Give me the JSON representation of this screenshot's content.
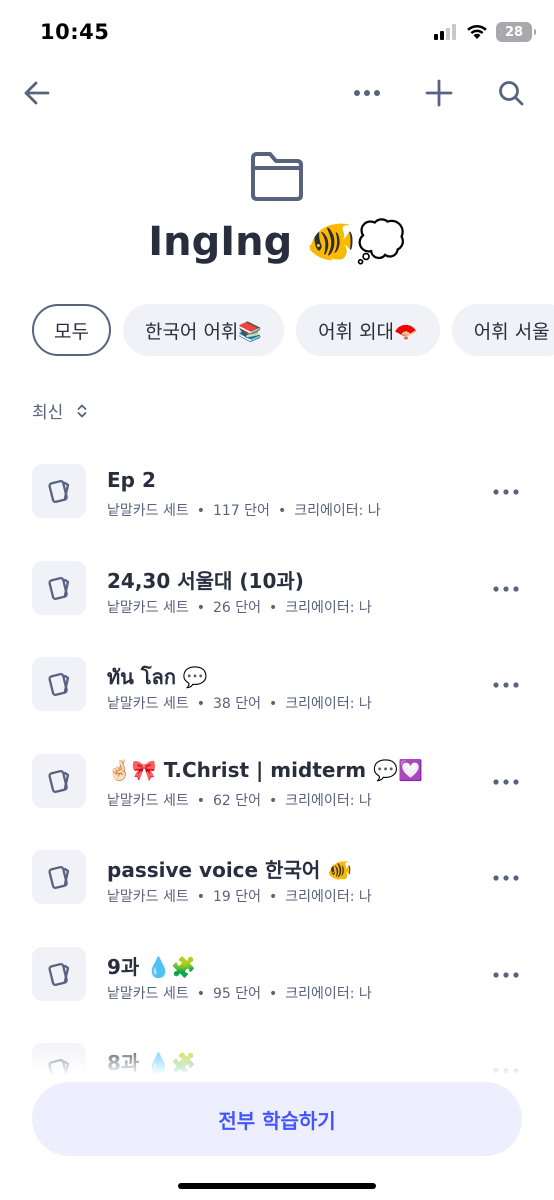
{
  "status": {
    "time": "10:45",
    "battery": "28"
  },
  "toolbar": {
    "icons": [
      "back-arrow-icon",
      "more-horizontal-icon",
      "plus-icon",
      "search-icon"
    ]
  },
  "folder": {
    "title": "IngIng 🐠💭"
  },
  "filters": [
    {
      "label": "모두",
      "active": true
    },
    {
      "label": "한국어 어휘📚",
      "active": false
    },
    {
      "label": "어휘 외대🪭",
      "active": false
    },
    {
      "label": "어휘 서울",
      "active": false
    }
  ],
  "sort": {
    "label": "최신"
  },
  "sets": [
    {
      "title": "Ep 2",
      "type": "낱말카드 세트",
      "count": "117 단어",
      "creator": "크리에이터: 나"
    },
    {
      "title": "24,30 서울대 (10과)",
      "type": "낱말카드 세트",
      "count": "26 단어",
      "creator": "크리에이터: 나"
    },
    {
      "title": "ทัน โลก 💬",
      "type": "낱말카드 세트",
      "count": "38 단어",
      "creator": "크리에이터: 나"
    },
    {
      "title": "🤞🏻🎀 T.Christ | midterm 💬💟",
      "type": "낱말카드 세트",
      "count": "62 단어",
      "creator": "크리에이터: 나"
    },
    {
      "title": "passive voice 한국어 🐠",
      "type": "낱말카드 세트",
      "count": "19 단어",
      "creator": "크리에이터: 나"
    },
    {
      "title": "9과 💧🧩",
      "type": "낱말카드 세트",
      "count": "95 단어",
      "creator": "크리에이터: 나"
    },
    {
      "title": "8과 💧🧩",
      "type": "낱말카드 세트",
      "count": "",
      "creator": ""
    }
  ],
  "study_all_label": "전부 학습하기",
  "colors": {
    "primary_text": "#282e3e",
    "secondary_text": "#586380",
    "accent": "#4255ff",
    "chip_bg": "#f0f2f7",
    "button_bg": "#edefff"
  }
}
